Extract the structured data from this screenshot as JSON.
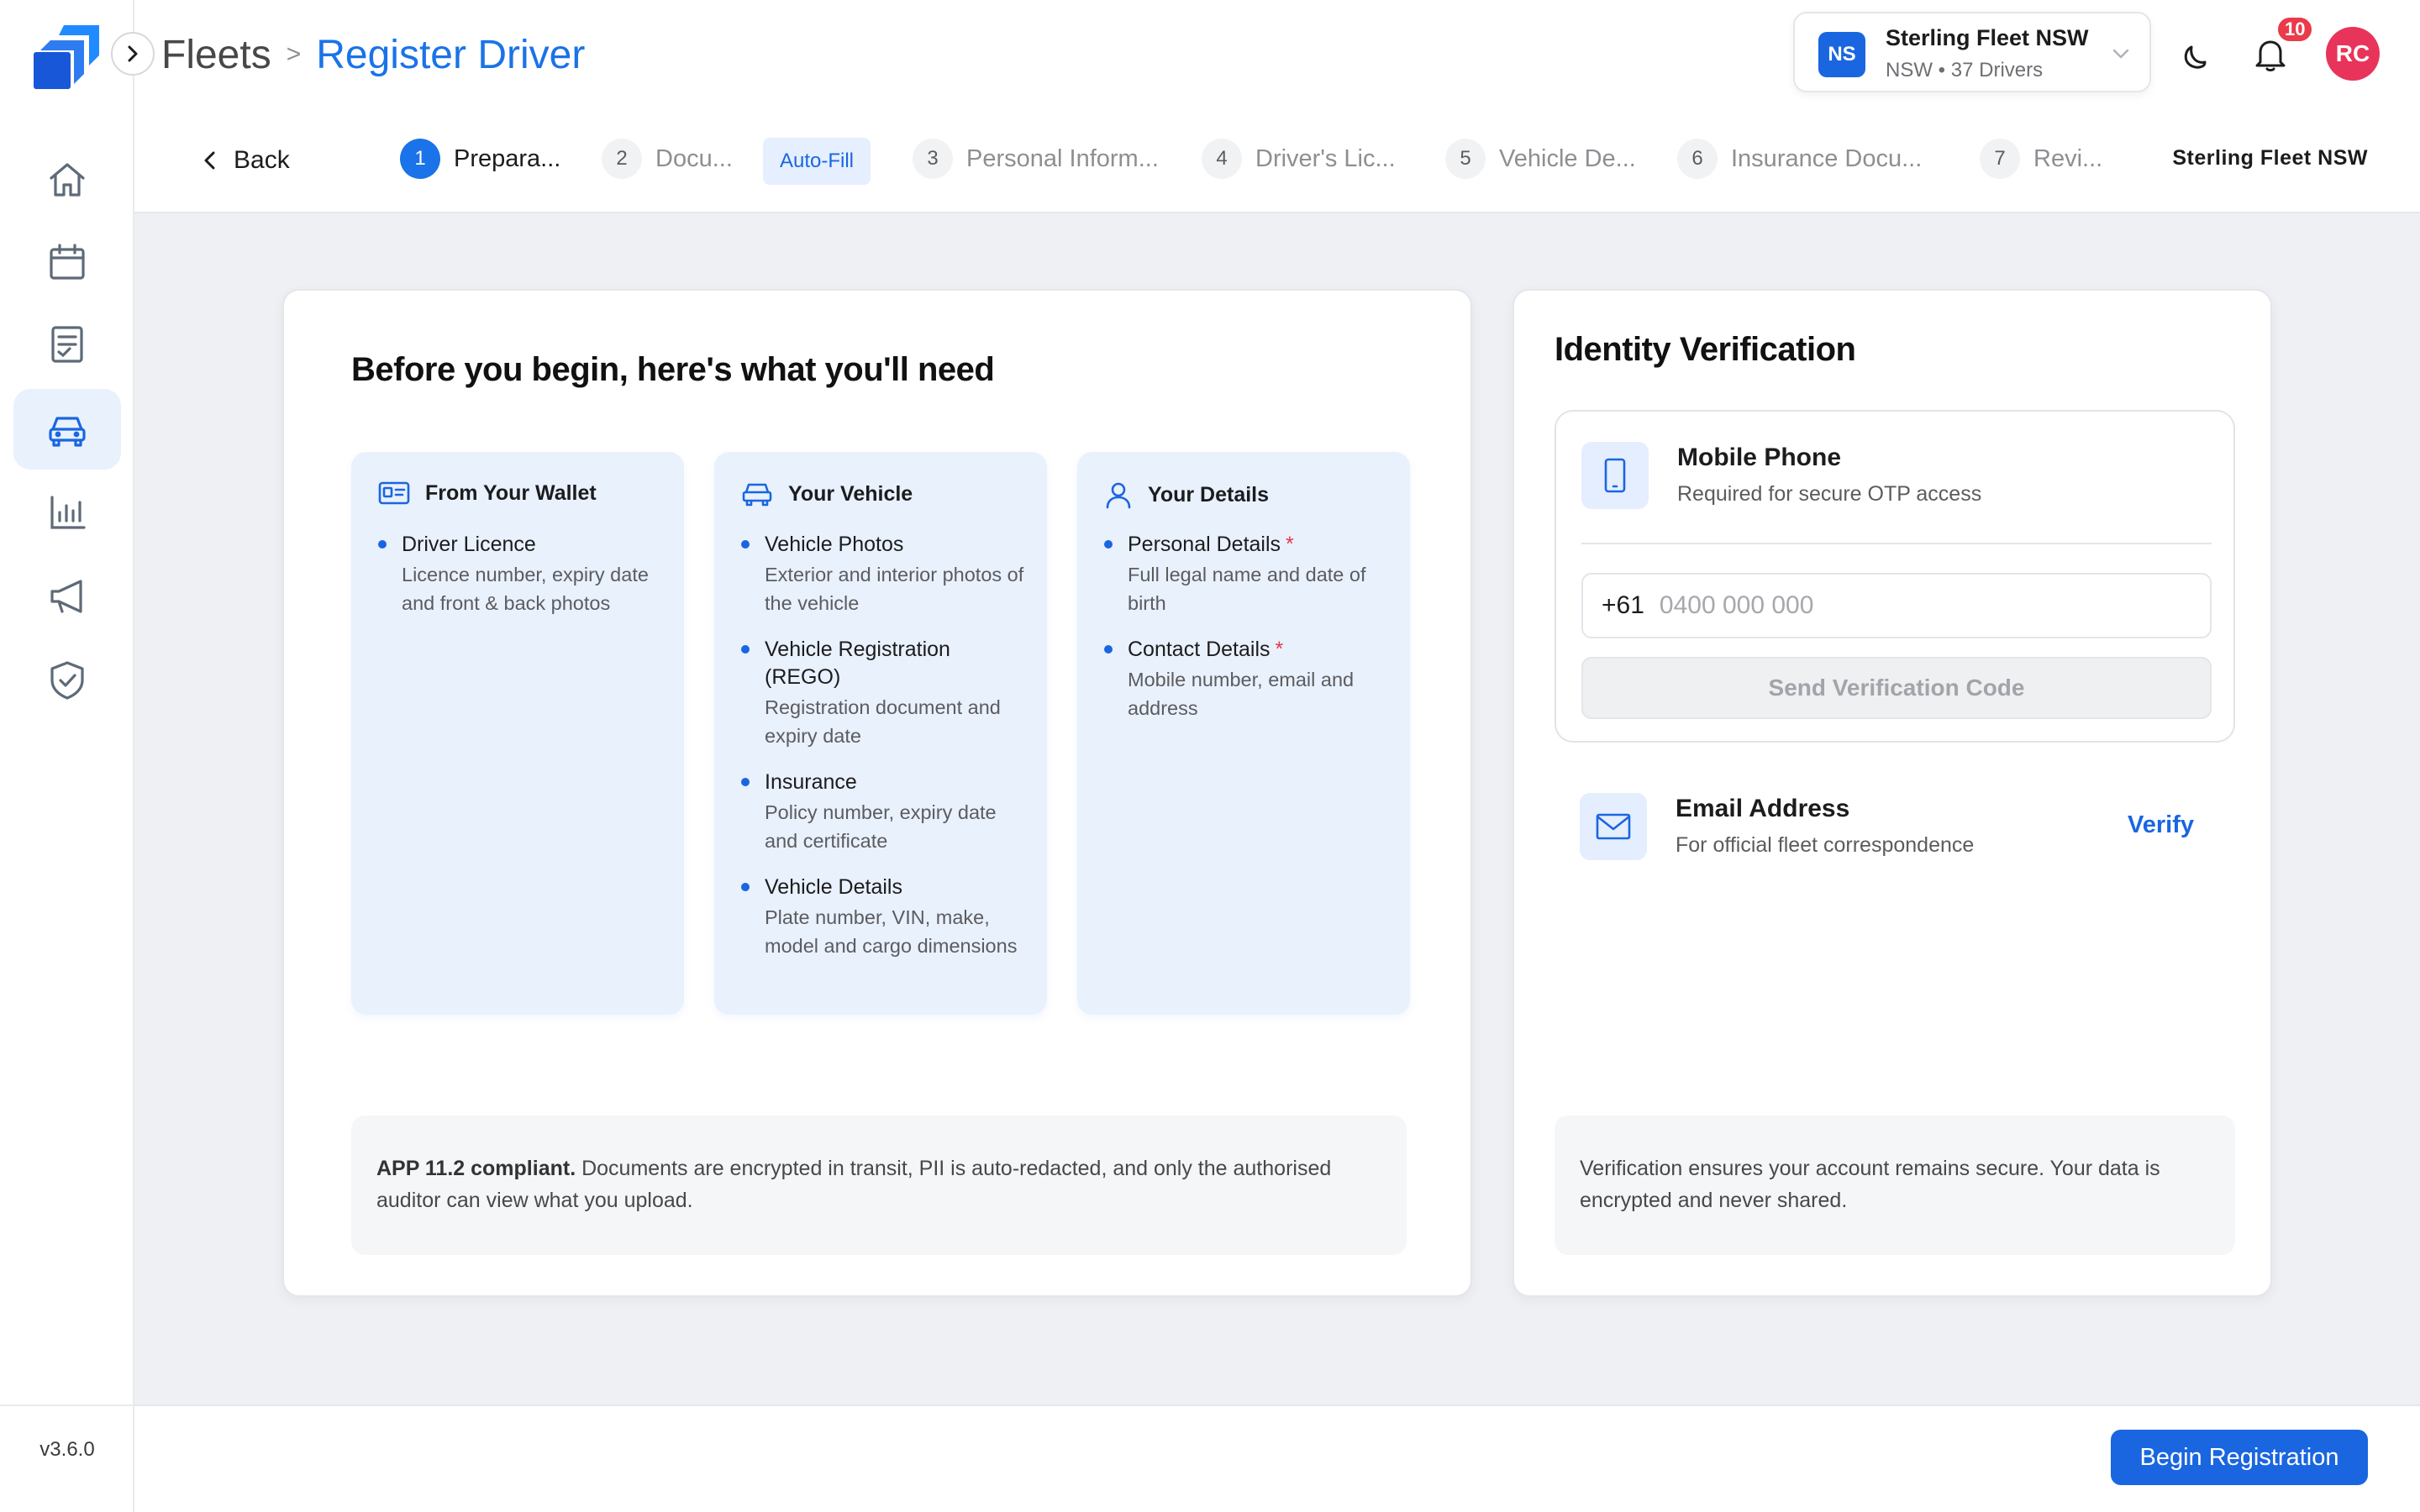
{
  "app": {
    "version": "v3.6.0",
    "colors": {
      "accent": "#1a66e0",
      "accent_soft": "#e9f1fd",
      "danger": "#ea3b4b",
      "avatar": "#e8345a"
    }
  },
  "sidebar": {
    "items": [
      {
        "name": "home",
        "icon": "home-icon",
        "active": false
      },
      {
        "name": "calendar",
        "icon": "calendar-icon",
        "active": false
      },
      {
        "name": "documents",
        "icon": "document-icon",
        "active": false
      },
      {
        "name": "fleets",
        "icon": "car-icon",
        "active": true
      },
      {
        "name": "analytics",
        "icon": "bar-chart-icon",
        "active": false
      },
      {
        "name": "announcements",
        "icon": "megaphone-icon",
        "active": false
      },
      {
        "name": "compliance",
        "icon": "shield-check-icon",
        "active": false
      }
    ]
  },
  "header": {
    "breadcrumb_root": "Fleets",
    "breadcrumb_sep": ">",
    "breadcrumb_current": "Register Driver",
    "org": {
      "initials": "NS",
      "name": "Sterling Fleet NSW",
      "region": "NSW",
      "dot": "•",
      "drivers": "37 Drivers"
    },
    "notifications_count": "10",
    "avatar_initials": "RC"
  },
  "stepper": {
    "back_label": "Back",
    "autofill_label": "Auto-Fill",
    "org_label": "Sterling Fleet NSW",
    "steps": [
      {
        "num": "1",
        "label": "Prepara...",
        "active": true
      },
      {
        "num": "2",
        "label": "Docu...",
        "active": false
      },
      {
        "num": "3",
        "label": "Personal Inform...",
        "active": false
      },
      {
        "num": "4",
        "label": "Driver's Lic...",
        "active": false
      },
      {
        "num": "5",
        "label": "Vehicle De...",
        "active": false
      },
      {
        "num": "6",
        "label": "Insurance Docu...",
        "active": false
      },
      {
        "num": "7",
        "label": "Revi...",
        "active": false
      }
    ]
  },
  "requirements": {
    "title": "Before you begin, here's what you'll need",
    "columns": [
      {
        "title": "From Your Wallet",
        "icon": "id-card-icon",
        "items": [
          {
            "title": "Driver Licence",
            "desc": "Licence number, expiry date and front & back photos",
            "required": ""
          }
        ]
      },
      {
        "title": "Your Vehicle",
        "icon": "car-icon",
        "items": [
          {
            "title": "Vehicle Photos",
            "desc": "Exterior and interior photos of the vehicle",
            "required": ""
          },
          {
            "title": "Vehicle Registration (REGO)",
            "desc": "Registration document and expiry date",
            "required": ""
          },
          {
            "title": "Insurance",
            "desc": "Policy number, expiry date and certificate",
            "required": ""
          },
          {
            "title": "Vehicle Details",
            "desc": "Plate number, VIN, make, model and cargo dimensions",
            "required": ""
          }
        ]
      },
      {
        "title": "Your Details",
        "icon": "user-icon",
        "items": [
          {
            "title": "Personal Details",
            "desc": "Full legal name and date of birth",
            "required": "*"
          },
          {
            "title": "Contact Details",
            "desc": "Mobile number, email and address",
            "required": "*"
          }
        ]
      }
    ],
    "note_bold": "APP 11.2 compliant.",
    "note_text": " Documents are encrypted in transit, PII is auto-redacted, and only the authorised auditor can view what you upload."
  },
  "verification": {
    "title": "Identity Verification",
    "phone": {
      "title": "Mobile Phone",
      "subtitle": "Required for secure OTP access",
      "prefix": "+61",
      "placeholder": "0400 000 000",
      "send_label": "Send Verification Code"
    },
    "email": {
      "title": "Email Address",
      "subtitle": "For official fleet correspondence",
      "verify_label": "Verify"
    },
    "note": "Verification ensures your account remains secure. Your data is encrypted and never shared."
  },
  "footer": {
    "begin_label": "Begin Registration"
  }
}
